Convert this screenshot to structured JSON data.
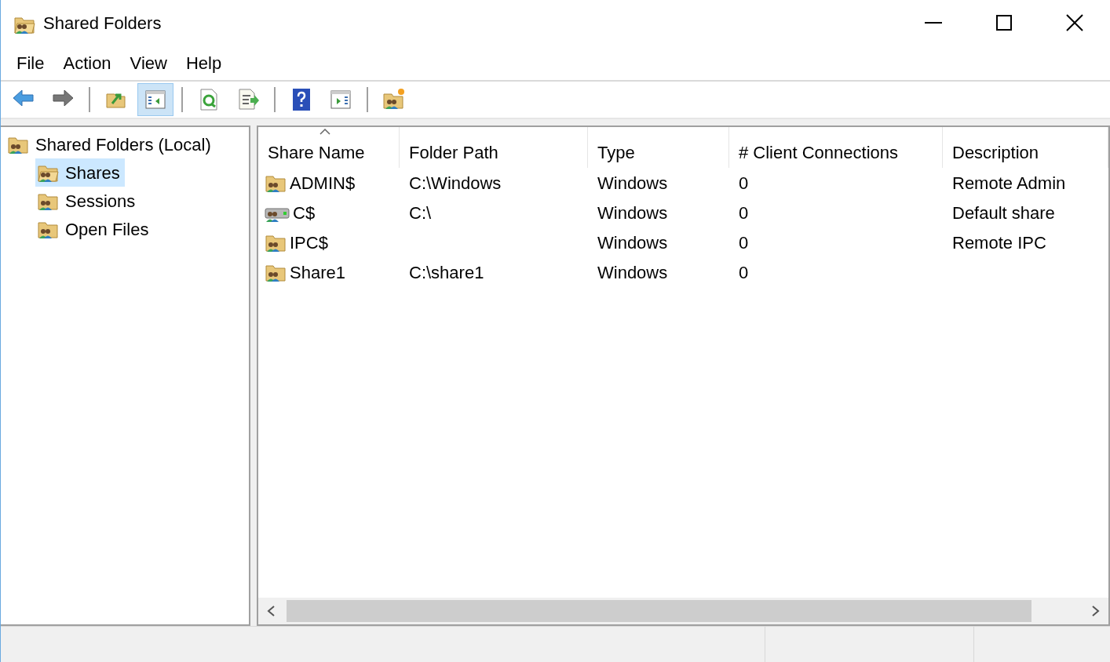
{
  "window": {
    "title": "Shared Folders"
  },
  "menu": [
    "File",
    "Action",
    "View",
    "Help"
  ],
  "toolbar": [
    {
      "kind": "back",
      "pressed": false
    },
    {
      "kind": "forward",
      "pressed": false
    },
    {
      "kind": "separator"
    },
    {
      "kind": "up",
      "pressed": false
    },
    {
      "kind": "tree",
      "pressed": true
    },
    {
      "kind": "separator"
    },
    {
      "kind": "refresh",
      "pressed": false
    },
    {
      "kind": "export",
      "pressed": false
    },
    {
      "kind": "separator"
    },
    {
      "kind": "help",
      "pressed": false
    },
    {
      "kind": "action-pane",
      "pressed": false
    },
    {
      "kind": "separator"
    },
    {
      "kind": "new-share",
      "pressed": false
    }
  ],
  "tree": [
    {
      "label": "Shared Folders (Local)",
      "selected": false,
      "children": [
        {
          "label": "Shares",
          "selected": true
        },
        {
          "label": "Sessions",
          "selected": false
        },
        {
          "label": "Open Files",
          "selected": false
        }
      ]
    }
  ],
  "table": {
    "columns": [
      {
        "label": "Share Name",
        "sorted": true
      },
      {
        "label": "Folder Path",
        "sorted": false
      },
      {
        "label": "Type",
        "sorted": false
      },
      {
        "label": "# Client Connections",
        "sorted": false
      },
      {
        "label": "Description",
        "sorted": false
      }
    ],
    "rows": [
      {
        "kind": "folder",
        "cells": [
          "ADMIN$",
          "C:\\Windows",
          "Windows",
          "0",
          "Remote Admin"
        ]
      },
      {
        "kind": "drive",
        "cells": [
          "C$",
          "C:\\",
          "Windows",
          "0",
          "Default share"
        ]
      },
      {
        "kind": "folder",
        "cells": [
          "IPC$",
          "",
          "Windows",
          "0",
          "Remote IPC"
        ]
      },
      {
        "kind": "folder",
        "cells": [
          "Share1",
          "C:\\share1",
          "Windows",
          "0",
          ""
        ]
      }
    ]
  }
}
